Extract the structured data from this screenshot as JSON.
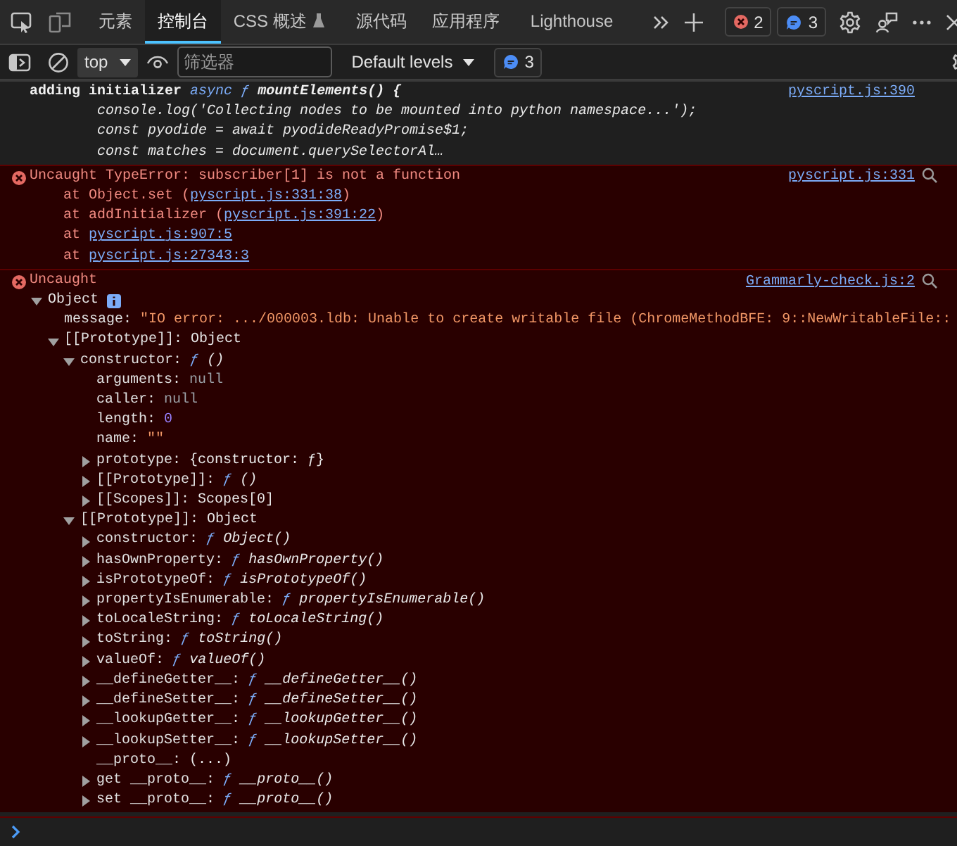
{
  "tab_bar": {
    "tabs": [
      {
        "label": "元素",
        "selected": false,
        "experimental": false
      },
      {
        "label": "控制台",
        "selected": true,
        "experimental": false
      },
      {
        "label": "CSS 概述",
        "selected": false,
        "experimental": true
      },
      {
        "label": "源代码",
        "selected": false,
        "experimental": false
      },
      {
        "label": "应用程序",
        "selected": false,
        "experimental": false
      },
      {
        "label": "Lighthouse",
        "selected": false,
        "experimental": false
      }
    ],
    "error_count": "2",
    "message_count": "3"
  },
  "filter_bar": {
    "context": "top",
    "filter_placeholder": "筛选器",
    "levels": "Default levels",
    "issues_count": "3"
  },
  "messages": [
    {
      "kind": "log",
      "source": "pyscript.js:390",
      "label": "adding initializer",
      "keyword": "async",
      "sign": "ƒ",
      "head": "mountElements() {",
      "body": [
        "console.log('Collecting nodes to be mounted into python namespace...');",
        "const pyodide = await pyodideReadyPromise$1;",
        "const matches = document.querySelectorAl…"
      ]
    },
    {
      "kind": "error",
      "source": "pyscript.js:331",
      "text": "Uncaught TypeError: subscriber[1] is not a function",
      "stack": [
        {
          "prefix": "at Object.set (",
          "link": "pyscript.js:331:38",
          "suffix": ")"
        },
        {
          "prefix": "at addInitializer (",
          "link": "pyscript.js:391:22",
          "suffix": ")"
        },
        {
          "prefix": "at ",
          "link": "pyscript.js:907:5"
        },
        {
          "prefix": "at ",
          "link": "pyscript.js:27343:3"
        }
      ]
    },
    {
      "kind": "error",
      "source": "Grammarly-check.js:2",
      "text": "Uncaught",
      "tree": [
        {
          "expanded": true,
          "kind": "object",
          "value": "Object",
          "children": [
            {
              "key": "message:",
              "kind": "string",
              "value": "\"IO error: .../000003.ldb: Unable to create writable file (ChromeMethodBFE: 9::NewWritableFile::"
            },
            {
              "expanded": true,
              "key": "[[Prototype]]:",
              "kind": "object",
              "value": "Object",
              "children": [
                {
                  "expanded": true,
                  "key": "constructor:",
                  "kind": "function",
                  "sign": "ƒ",
                  "value": "()",
                  "children": [
                    {
                      "key": "arguments:",
                      "kind": "null",
                      "value": "null"
                    },
                    {
                      "key": "caller:",
                      "kind": "null",
                      "value": "null"
                    },
                    {
                      "key": "length:",
                      "kind": "number",
                      "value": "0"
                    },
                    {
                      "key": "name:",
                      "kind": "string",
                      "value": "\"\""
                    },
                    {
                      "expanded": false,
                      "key": "prototype:",
                      "kind": "object",
                      "value": "{constructor: ƒ}"
                    },
                    {
                      "expanded": false,
                      "key": "[[Prototype]]:",
                      "kind": "function",
                      "sign": "ƒ",
                      "value": "()"
                    },
                    {
                      "expanded": false,
                      "key": "[[Scopes]]:",
                      "kind": "object",
                      "value": "Scopes[0]"
                    }
                  ]
                },
                {
                  "expanded": true,
                  "key": "[[Prototype]]:",
                  "kind": "object",
                  "value": "Object",
                  "children": [
                    {
                      "expanded": false,
                      "key": "constructor:",
                      "kind": "function",
                      "sign": "ƒ",
                      "value": "Object()"
                    },
                    {
                      "expanded": false,
                      "key": "hasOwnProperty:",
                      "kind": "function",
                      "sign": "ƒ",
                      "value": "hasOwnProperty()"
                    },
                    {
                      "expanded": false,
                      "key": "isPrototypeOf:",
                      "kind": "function",
                      "sign": "ƒ",
                      "value": "isPrototypeOf()"
                    },
                    {
                      "expanded": false,
                      "key": "propertyIsEnumerable:",
                      "kind": "function",
                      "sign": "ƒ",
                      "value": "propertyIsEnumerable()"
                    },
                    {
                      "expanded": false,
                      "key": "toLocaleString:",
                      "kind": "function",
                      "sign": "ƒ",
                      "value": "toLocaleString()"
                    },
                    {
                      "expanded": false,
                      "key": "toString:",
                      "kind": "function",
                      "sign": "ƒ",
                      "value": "toString()"
                    },
                    {
                      "expanded": false,
                      "key": "valueOf:",
                      "kind": "function",
                      "sign": "ƒ",
                      "value": "valueOf()"
                    },
                    {
                      "expanded": false,
                      "key": "__defineGetter__:",
                      "kind": "function",
                      "sign": "ƒ",
                      "value": "__defineGetter__()"
                    },
                    {
                      "expanded": false,
                      "key": "__defineSetter__:",
                      "kind": "function",
                      "sign": "ƒ",
                      "value": "__defineSetter__()"
                    },
                    {
                      "expanded": false,
                      "key": "__lookupGetter__:",
                      "kind": "function",
                      "sign": "ƒ",
                      "value": "__lookupGetter__()"
                    },
                    {
                      "expanded": false,
                      "key": "__lookupSetter__:",
                      "kind": "function",
                      "sign": "ƒ",
                      "value": "__lookupSetter__()"
                    },
                    {
                      "key": "__proto__:",
                      "kind": "object",
                      "value": "(...)"
                    },
                    {
                      "expanded": false,
                      "key": "get __proto__:",
                      "kind": "function",
                      "sign": "ƒ",
                      "value": "__proto__()"
                    },
                    {
                      "expanded": false,
                      "key": "set __proto__:",
                      "kind": "function",
                      "sign": "ƒ",
                      "value": "__proto__()"
                    }
                  ]
                }
              ]
            }
          ]
        }
      ]
    }
  ]
}
